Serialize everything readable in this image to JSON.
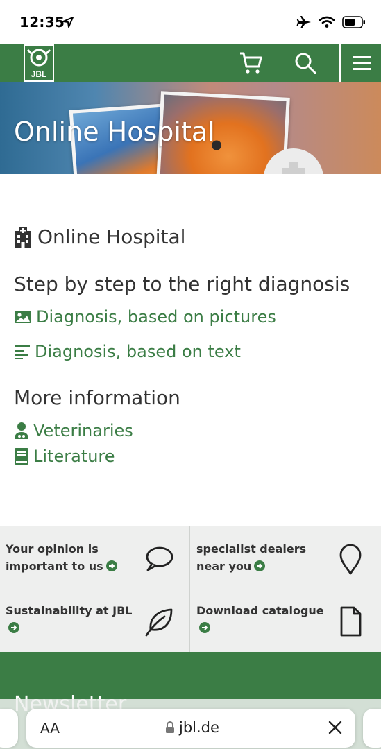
{
  "status": {
    "time": "12:35"
  },
  "header": {
    "logo_text": "JBL"
  },
  "hero": {
    "title": "Online Hospital"
  },
  "content": {
    "hospital_title": "Online Hospital",
    "step_title": "Step by step to the right diagnosis",
    "links": [
      {
        "label": "Diagnosis, based on pictures",
        "icon": "image-icon"
      },
      {
        "label": "Diagnosis, based on text",
        "icon": "text-lines-icon"
      }
    ],
    "more_title": "More information",
    "more_links": [
      {
        "label": "Veterinaries",
        "icon": "doctor-icon"
      },
      {
        "label": "Literature",
        "icon": "book-icon"
      }
    ]
  },
  "grid": {
    "opinion": "Your opinion is important to us",
    "dealers": "specialist dealers near you",
    "sustainability": "Sustainability at JBL",
    "catalogue": "Download catalogue"
  },
  "footer": {
    "newsletter": "Newsletter"
  },
  "safari": {
    "aa": "AA",
    "url": "jbl.de"
  },
  "colors": {
    "brand_green": "#3b7d45",
    "grid_bg": "#eeefee"
  }
}
